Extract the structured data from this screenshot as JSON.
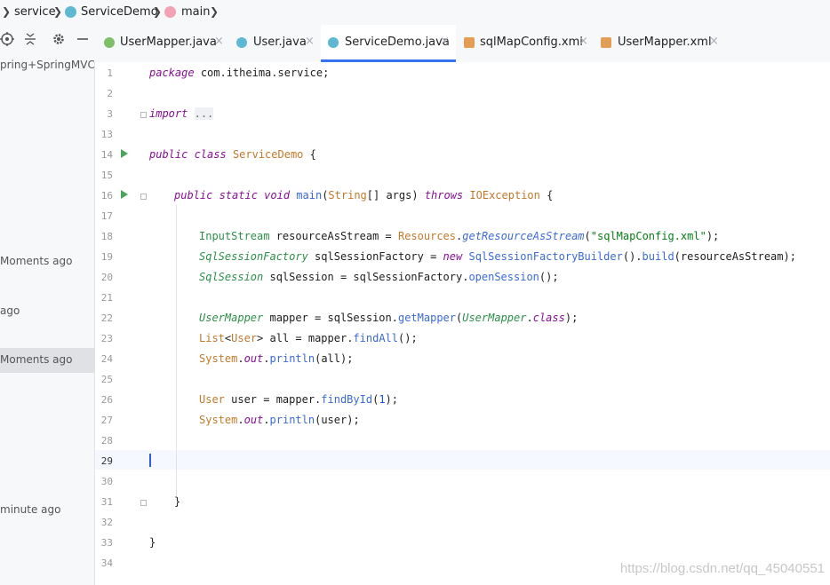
{
  "breadcrumb": {
    "items": [
      "service",
      "ServiceDemo",
      "main"
    ]
  },
  "tabs": [
    {
      "label": "UserMapper.java",
      "icon": "interface-icon",
      "active": false
    },
    {
      "label": "User.java",
      "icon": "class-icon",
      "active": false
    },
    {
      "label": "ServiceDemo.java",
      "icon": "class-icon",
      "active": true
    },
    {
      "label": "sqlMapConfig.xml",
      "icon": "xml-icon",
      "active": false
    },
    {
      "label": "UserMapper.xml",
      "icon": "xml-icon",
      "active": false
    }
  ],
  "tab_close": "×",
  "left_panel": {
    "items": [
      "pring+SpringMVC",
      "Moments ago",
      "ago",
      "Moments ago",
      "minute ago"
    ]
  },
  "editor": {
    "line_numbers": [
      "1",
      "2",
      "3",
      "13",
      "14",
      "15",
      "16",
      "17",
      "18",
      "19",
      "20",
      "21",
      "22",
      "23",
      "24",
      "25",
      "26",
      "27",
      "28",
      "29",
      "30",
      "31",
      "32",
      "33",
      "34"
    ],
    "current_line": "29",
    "fold_placeholder": "...",
    "package_name": "com.itheima.service",
    "class_name": "ServiceDemo",
    "config_file": "\"sqlMapConfig.xml\"",
    "find_by_id_arg": "1"
  },
  "watermark": "https://blog.csdn.net/qq_45040551",
  "colors": {
    "accent": "#3574f0",
    "keyword": "#871094",
    "string": "#067d17",
    "run": "#4aa55a"
  }
}
